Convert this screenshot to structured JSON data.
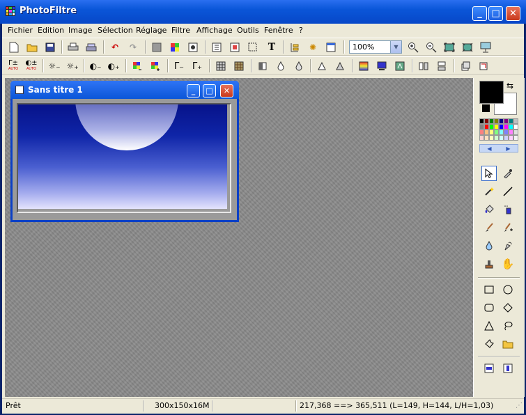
{
  "app": {
    "title": "PhotoFiltre"
  },
  "menu": [
    "Fichier",
    "Edition",
    "Image",
    "Sélection",
    "Réglage",
    "Filtre",
    "Affichage",
    "Outils",
    "Fenêtre",
    "?"
  ],
  "toolbar1": {
    "buttons": [
      "new-icon",
      "open-icon",
      "save-icon",
      "print-icon",
      "scan-icon",
      "undo-icon",
      "redo-icon",
      "gray-icon",
      "palette-icon",
      "mask-icon",
      "doc-icon",
      "frame-icon",
      "selection-icon",
      "text-icon",
      "browser-icon",
      "gear-icon",
      "window-icon"
    ],
    "zoom_value": "100%",
    "zoom_buttons": [
      "zoom-in-icon",
      "zoom-out-icon",
      "fit-icon",
      "full-size-icon",
      "slideshow-icon"
    ]
  },
  "toolbar2": {
    "auto_label": "AUTO",
    "buttons": [
      "levels-auto-icon",
      "contrast-auto-icon",
      "brightness-minus-icon",
      "brightness-plus-icon",
      "contrast-minus-icon",
      "contrast-plus-icon",
      "saturation-minus-icon",
      "saturation-plus-icon",
      "gamma-minus-icon",
      "gamma-plus-icon",
      "grid-icon",
      "texture-icon",
      "sharpen-icon",
      "drop-icon",
      "drop-outline-icon",
      "triangle-icon",
      "triangle-outline-icon",
      "gradient-icon",
      "rainbow-icon",
      "effect-icon",
      "flip-h-icon",
      "flip-v-icon",
      "rotate-icon",
      "crop-icon"
    ]
  },
  "document": {
    "title": "Sans titre 1"
  },
  "tools": [
    "select-arrow-icon",
    "eyedropper-icon",
    "magic-wand-icon",
    "line-icon",
    "fill-bucket-icon",
    "spray-icon",
    "brush-icon",
    "advanced-brush-icon",
    "blur-drop-icon",
    "smudge-icon",
    "stamp-icon",
    "hand-icon",
    "rectangle-icon",
    "ellipse-icon",
    "rounded-rect-icon",
    "diamond-icon",
    "triangle-shape-icon",
    "lasso-icon",
    "polygon-lasso-icon",
    "folder-icon",
    "select-mode-a-icon",
    "select-mode-b-icon"
  ],
  "colors": {
    "foreground": "#000000",
    "background": "#ffffff",
    "accent": "#0a56d8"
  },
  "palette": [
    "#000000",
    "#800000",
    "#008000",
    "#808000",
    "#000080",
    "#800080",
    "#008080",
    "#c0c0c0",
    "#808080",
    "#ff0000",
    "#00ff00",
    "#ffff00",
    "#0000ff",
    "#ff00ff",
    "#00ffff",
    "#ffffff",
    "#ff8080",
    "#ffc080",
    "#ffff80",
    "#80ff80",
    "#80ffff",
    "#8080ff",
    "#ff80ff",
    "#e0e0e0",
    "#ffd0d0",
    "#ffe0c0",
    "#ffffc0",
    "#d0ffd0",
    "#d0ffff",
    "#d0d0ff",
    "#ffd0ff",
    "#f4f4f4"
  ],
  "status": {
    "state": "Prêt",
    "image_info": "300x150x16M",
    "coords": "217,368 ==> 365,511 (L=149, H=144, L/H=1,03)"
  }
}
